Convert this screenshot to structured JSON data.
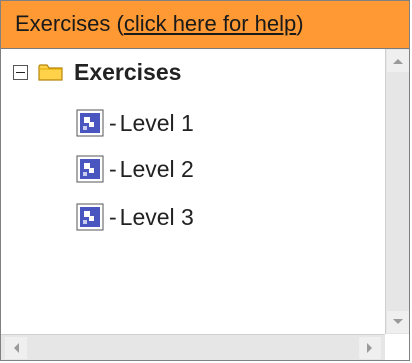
{
  "header": {
    "title": "Exercises",
    "help_link": "click here for help",
    "background_color": "#ff9933"
  },
  "tree": {
    "root": {
      "label": "Exercises",
      "expander_icon": "collapse-minus-icon",
      "icon": "folder-icon",
      "expanded": true
    },
    "items": [
      {
        "label": "Level 1",
        "prefix": "-",
        "icon": "exercise-icon"
      },
      {
        "label": "Level 2",
        "prefix": "-",
        "icon": "exercise-icon"
      },
      {
        "label": "Level 3",
        "prefix": "-",
        "icon": "exercise-icon"
      }
    ]
  },
  "scrollbars": {
    "vertical_icons": [
      "scroll-up-arrow-icon",
      "scroll-down-arrow-icon"
    ],
    "horizontal_icons": [
      "scroll-left-arrow-icon",
      "scroll-right-arrow-icon"
    ]
  }
}
